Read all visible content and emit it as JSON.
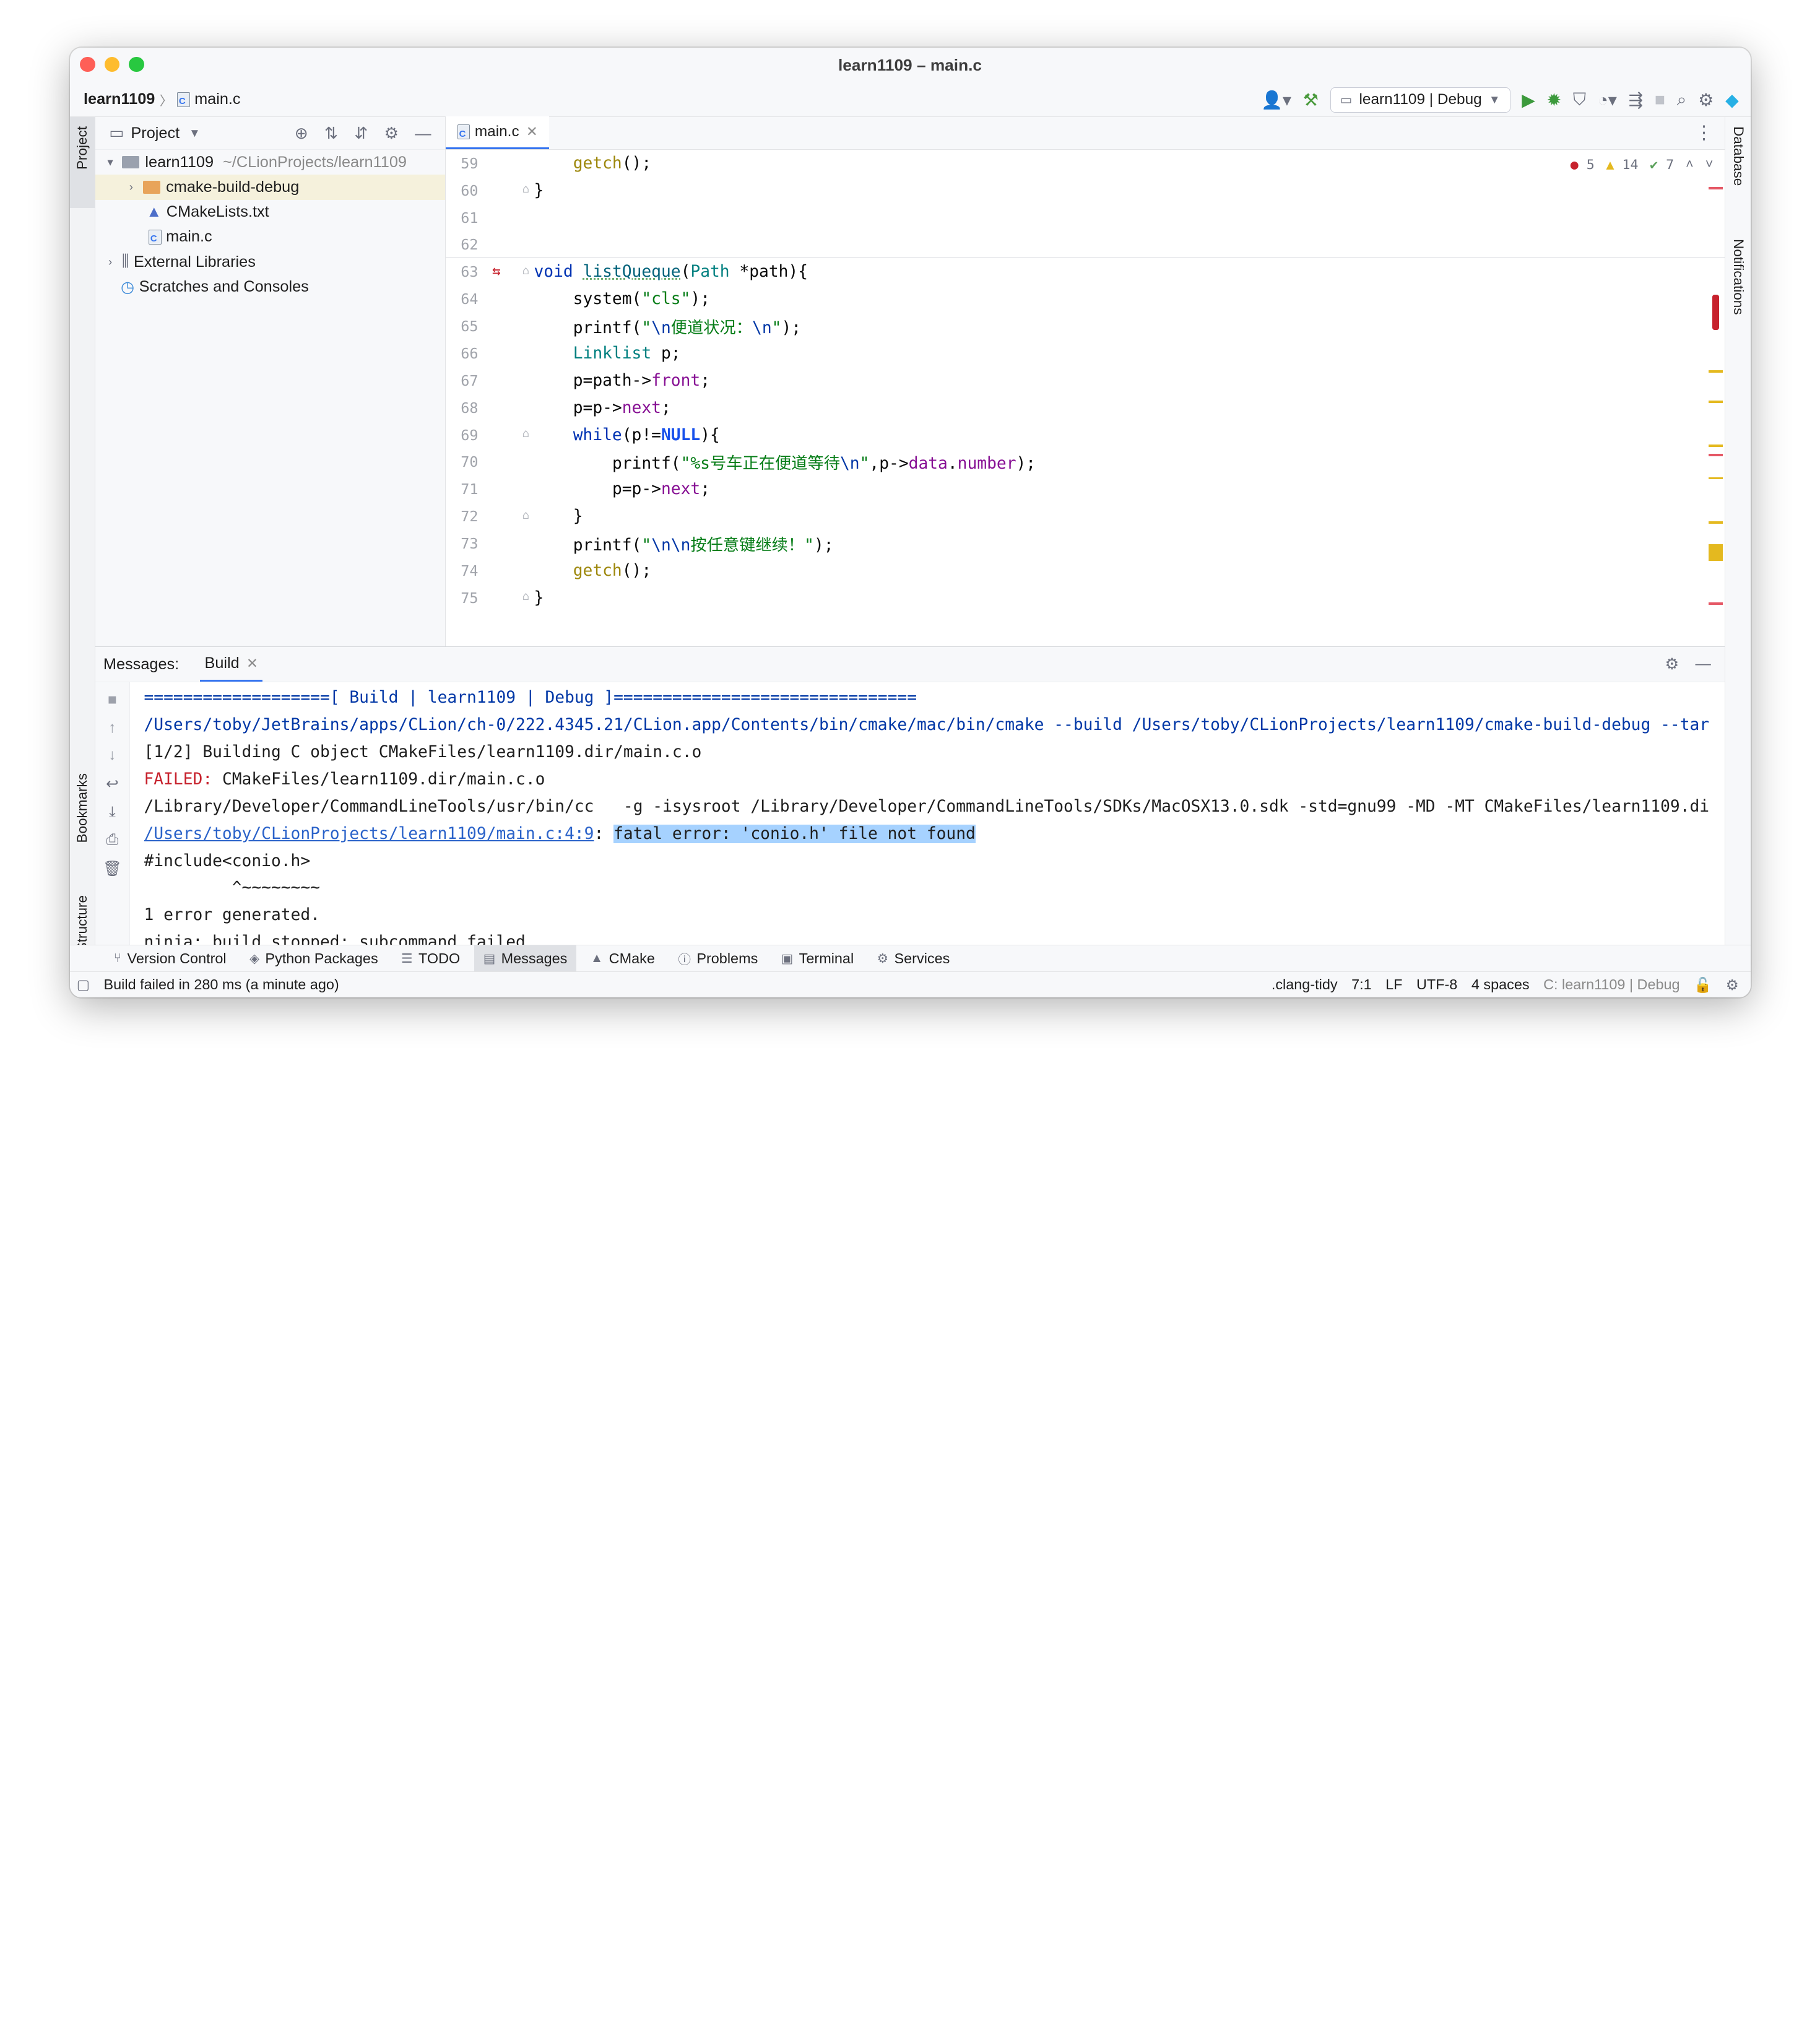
{
  "window": {
    "title": "learn1109 – main.c"
  },
  "navbar": {
    "project": "learn1109",
    "file": "main.c",
    "run_config": "learn1109 | Debug"
  },
  "project_panel": {
    "title": "Project",
    "tree": [
      {
        "label": "learn1109",
        "hint": "~/CLionProjects/learn1109"
      },
      {
        "label": "cmake-build-debug"
      },
      {
        "label": "CMakeLists.txt"
      },
      {
        "label": "main.c"
      },
      {
        "label": "External Libraries"
      },
      {
        "label": "Scratches and Consoles"
      }
    ]
  },
  "left_toolwindows": {
    "project": "Project",
    "bookmarks": "Bookmarks",
    "structure": "Structure"
  },
  "right_toolwindows": {
    "database": "Database",
    "notifications": "Notifications"
  },
  "editor": {
    "tab": "main.c",
    "inspections": {
      "errors": "5",
      "warnings": "14",
      "weak": "7"
    },
    "lines": [
      {
        "n": "59"
      },
      {
        "n": "60"
      },
      {
        "n": "61"
      },
      {
        "n": "62"
      },
      {
        "n": "63"
      },
      {
        "n": "64"
      },
      {
        "n": "65"
      },
      {
        "n": "66"
      },
      {
        "n": "67"
      },
      {
        "n": "68"
      },
      {
        "n": "69"
      },
      {
        "n": "70"
      },
      {
        "n": "71"
      },
      {
        "n": "72"
      },
      {
        "n": "73"
      },
      {
        "n": "74"
      },
      {
        "n": "75"
      }
    ],
    "code": {
      "l59_fn": "getch",
      "l59_rest": "();",
      "l60": "}",
      "l63_kw": "void",
      "l63_fn": "listQueque",
      "l63_p1": "(",
      "l63_type": "Path",
      "l63_rest": " *path){",
      "l64_a": "system(",
      "l64_str": "\"cls\"",
      "l64_b": ");",
      "l65_a": "printf(",
      "l65_q1": "\"",
      "l65_esc1": "\\n",
      "l65_mid": "便道状况：",
      "l65_esc2": "\\n",
      "l65_q2": "\"",
      "l65_b": ");",
      "l66_type": "Linklist",
      "l66_rest": " p;",
      "l67_a": "p=path->",
      "l67_mem": "front",
      "l67_b": ";",
      "l68_a": "p=p->",
      "l68_mem": "next",
      "l68_b": ";",
      "l69_kw": "while",
      "l69_a": "(p!=",
      "l69_mac": "NULL",
      "l69_b": "){",
      "l70_a": "printf(",
      "l70_str": "\"%s号车正在便道等待",
      "l70_esc": "\\n",
      "l70_q": "\"",
      "l70_b": ",p->",
      "l70_mem1": "data",
      "l70_dot": ".",
      "l70_mem2": "number",
      "l70_c": ");",
      "l71_a": "p=p->",
      "l71_mem": "next",
      "l71_b": ";",
      "l72": "}",
      "l73_a": "printf(",
      "l73_q1": "\"",
      "l73_esc": "\\n\\n",
      "l73_mid": "按任意键继续！",
      "l73_q2": "\"",
      "l73_b": ");",
      "l74_fn": "getch",
      "l74_rest": "();",
      "l75": "}"
    }
  },
  "messages": {
    "label": "Messages:",
    "tab": "Build",
    "output": {
      "o1": "===================[ Build | learn1109 | Debug ]===============================",
      "o2": "/Users/toby/JetBrains/apps/CLion/ch-0/222.4345.21/CLion.app/Contents/bin/cmake/mac/bin/cmake --build /Users/toby/CLionProjects/learn1109/cmake-build-debug --tar",
      "o3": "[1/2] Building C object CMakeFiles/learn1109.dir/main.c.o",
      "o4_failed": "FAILED:",
      "o4_rest": " CMakeFiles/learn1109.dir/main.c.o",
      "o5": "/Library/Developer/CommandLineTools/usr/bin/cc   -g -isysroot /Library/Developer/CommandLineTools/SDKs/MacOSX13.0.sdk -std=gnu99 -MD -MT CMakeFiles/learn1109.di",
      "o6_link": "/Users/toby/CLionProjects/learn1109/main.c:4:9",
      "o6_colon": ": ",
      "o6_err": "fatal error: 'conio.h' file not found",
      "o7": "#include<conio.h>",
      "o8": "         ^~~~~~~~~",
      "o9": "1 error generated.",
      "o10": "ninja: build stopped: subcommand failed."
    }
  },
  "bottom_tabs": [
    "Version Control",
    "Python Packages",
    "TODO",
    "Messages",
    "CMake",
    "Problems",
    "Terminal",
    "Services"
  ],
  "status": {
    "message": "Build failed in 280 ms (a minute ago)",
    "tidy": ".clang-tidy",
    "position": "7:1",
    "line_sep": "LF",
    "encoding": "UTF-8",
    "indent": "4 spaces",
    "context": "C: learn1109 | Debug"
  },
  "colors": {
    "accent": "#3574f0",
    "error": "#c7222d",
    "warning": "#e4b91f",
    "selection": "#a6d2ff"
  }
}
